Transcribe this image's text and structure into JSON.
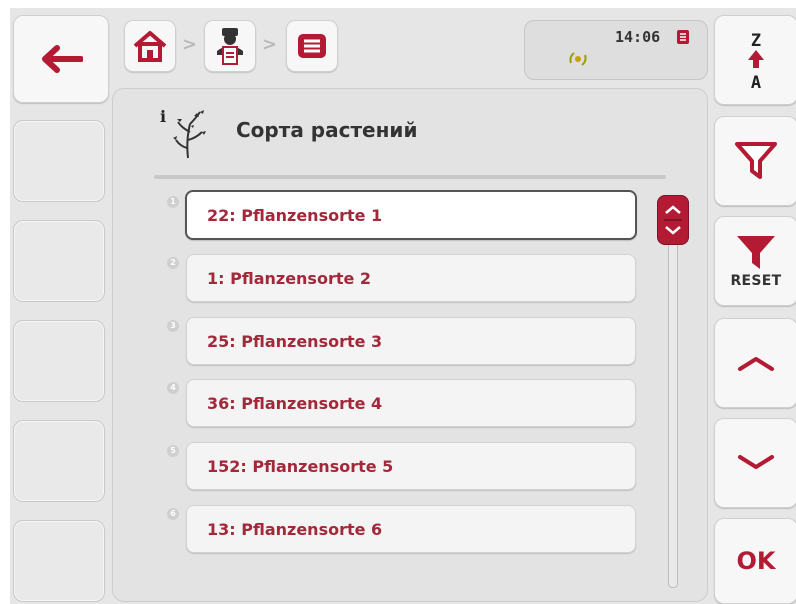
{
  "status": {
    "time": "14:06"
  },
  "title": "Сорта растений",
  "list": {
    "items": [
      {
        "index": "1",
        "label": "22: Pflanzensorte 1",
        "selected": true
      },
      {
        "index": "2",
        "label": "1: Pflanzensorte 2",
        "selected": false
      },
      {
        "index": "3",
        "label": "25: Pflanzensorte 3",
        "selected": false
      },
      {
        "index": "4",
        "label": "36: Pflanzensorte 4",
        "selected": false
      },
      {
        "index": "5",
        "label": "152: Pflanzensorte 5",
        "selected": false
      },
      {
        "index": "6",
        "label": "13: Pflanzensorte 6",
        "selected": false
      }
    ]
  },
  "sidebar_right": {
    "sort_top": "Z",
    "sort_bottom": "A",
    "reset_label": "RESET",
    "ok_label": "OK"
  },
  "colors": {
    "accent": "#b31b34",
    "text_red": "#a2283a"
  },
  "icons": [
    "back-arrow-icon",
    "home-icon",
    "operator-icon",
    "list-icon",
    "gps-icon",
    "document-icon",
    "plant-icon",
    "sort-icon",
    "filter-icon",
    "filter-reset-icon",
    "scroll-up-icon",
    "scroll-down-icon"
  ]
}
